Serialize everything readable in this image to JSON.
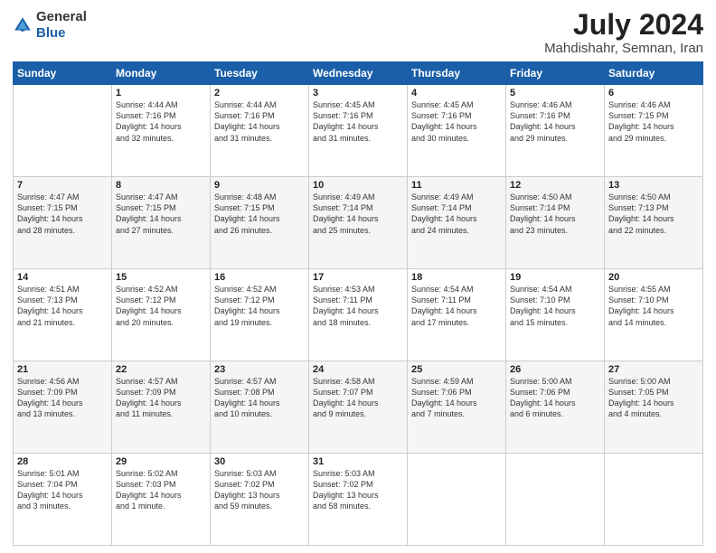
{
  "logo": {
    "general": "General",
    "blue": "Blue"
  },
  "title": "July 2024",
  "subtitle": "Mahdishahr, Semnan, Iran",
  "days": [
    "Sunday",
    "Monday",
    "Tuesday",
    "Wednesday",
    "Thursday",
    "Friday",
    "Saturday"
  ],
  "weeks": [
    [
      {
        "date": "",
        "info": ""
      },
      {
        "date": "1",
        "info": "Sunrise: 4:44 AM\nSunset: 7:16 PM\nDaylight: 14 hours\nand 32 minutes."
      },
      {
        "date": "2",
        "info": "Sunrise: 4:44 AM\nSunset: 7:16 PM\nDaylight: 14 hours\nand 31 minutes."
      },
      {
        "date": "3",
        "info": "Sunrise: 4:45 AM\nSunset: 7:16 PM\nDaylight: 14 hours\nand 31 minutes."
      },
      {
        "date": "4",
        "info": "Sunrise: 4:45 AM\nSunset: 7:16 PM\nDaylight: 14 hours\nand 30 minutes."
      },
      {
        "date": "5",
        "info": "Sunrise: 4:46 AM\nSunset: 7:16 PM\nDaylight: 14 hours\nand 29 minutes."
      },
      {
        "date": "6",
        "info": "Sunrise: 4:46 AM\nSunset: 7:15 PM\nDaylight: 14 hours\nand 29 minutes."
      }
    ],
    [
      {
        "date": "7",
        "info": "Sunrise: 4:47 AM\nSunset: 7:15 PM\nDaylight: 14 hours\nand 28 minutes."
      },
      {
        "date": "8",
        "info": "Sunrise: 4:47 AM\nSunset: 7:15 PM\nDaylight: 14 hours\nand 27 minutes."
      },
      {
        "date": "9",
        "info": "Sunrise: 4:48 AM\nSunset: 7:15 PM\nDaylight: 14 hours\nand 26 minutes."
      },
      {
        "date": "10",
        "info": "Sunrise: 4:49 AM\nSunset: 7:14 PM\nDaylight: 14 hours\nand 25 minutes."
      },
      {
        "date": "11",
        "info": "Sunrise: 4:49 AM\nSunset: 7:14 PM\nDaylight: 14 hours\nand 24 minutes."
      },
      {
        "date": "12",
        "info": "Sunrise: 4:50 AM\nSunset: 7:14 PM\nDaylight: 14 hours\nand 23 minutes."
      },
      {
        "date": "13",
        "info": "Sunrise: 4:50 AM\nSunset: 7:13 PM\nDaylight: 14 hours\nand 22 minutes."
      }
    ],
    [
      {
        "date": "14",
        "info": "Sunrise: 4:51 AM\nSunset: 7:13 PM\nDaylight: 14 hours\nand 21 minutes."
      },
      {
        "date": "15",
        "info": "Sunrise: 4:52 AM\nSunset: 7:12 PM\nDaylight: 14 hours\nand 20 minutes."
      },
      {
        "date": "16",
        "info": "Sunrise: 4:52 AM\nSunset: 7:12 PM\nDaylight: 14 hours\nand 19 minutes."
      },
      {
        "date": "17",
        "info": "Sunrise: 4:53 AM\nSunset: 7:11 PM\nDaylight: 14 hours\nand 18 minutes."
      },
      {
        "date": "18",
        "info": "Sunrise: 4:54 AM\nSunset: 7:11 PM\nDaylight: 14 hours\nand 17 minutes."
      },
      {
        "date": "19",
        "info": "Sunrise: 4:54 AM\nSunset: 7:10 PM\nDaylight: 14 hours\nand 15 minutes."
      },
      {
        "date": "20",
        "info": "Sunrise: 4:55 AM\nSunset: 7:10 PM\nDaylight: 14 hours\nand 14 minutes."
      }
    ],
    [
      {
        "date": "21",
        "info": "Sunrise: 4:56 AM\nSunset: 7:09 PM\nDaylight: 14 hours\nand 13 minutes."
      },
      {
        "date": "22",
        "info": "Sunrise: 4:57 AM\nSunset: 7:09 PM\nDaylight: 14 hours\nand 11 minutes."
      },
      {
        "date": "23",
        "info": "Sunrise: 4:57 AM\nSunset: 7:08 PM\nDaylight: 14 hours\nand 10 minutes."
      },
      {
        "date": "24",
        "info": "Sunrise: 4:58 AM\nSunset: 7:07 PM\nDaylight: 14 hours\nand 9 minutes."
      },
      {
        "date": "25",
        "info": "Sunrise: 4:59 AM\nSunset: 7:06 PM\nDaylight: 14 hours\nand 7 minutes."
      },
      {
        "date": "26",
        "info": "Sunrise: 5:00 AM\nSunset: 7:06 PM\nDaylight: 14 hours\nand 6 minutes."
      },
      {
        "date": "27",
        "info": "Sunrise: 5:00 AM\nSunset: 7:05 PM\nDaylight: 14 hours\nand 4 minutes."
      }
    ],
    [
      {
        "date": "28",
        "info": "Sunrise: 5:01 AM\nSunset: 7:04 PM\nDaylight: 14 hours\nand 3 minutes."
      },
      {
        "date": "29",
        "info": "Sunrise: 5:02 AM\nSunset: 7:03 PM\nDaylight: 14 hours\nand 1 minute."
      },
      {
        "date": "30",
        "info": "Sunrise: 5:03 AM\nSunset: 7:02 PM\nDaylight: 13 hours\nand 59 minutes."
      },
      {
        "date": "31",
        "info": "Sunrise: 5:03 AM\nSunset: 7:02 PM\nDaylight: 13 hours\nand 58 minutes."
      },
      {
        "date": "",
        "info": ""
      },
      {
        "date": "",
        "info": ""
      },
      {
        "date": "",
        "info": ""
      }
    ]
  ]
}
